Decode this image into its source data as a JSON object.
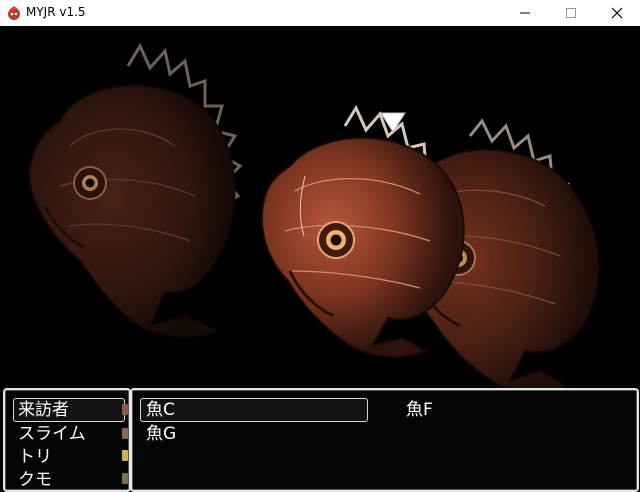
{
  "window": {
    "title": "MYJR v1.5",
    "minimize_glyph": "—",
    "maximize_glyph": "☐",
    "close_glyph": "✕"
  },
  "battle": {
    "cursor_icon": "down-triangle",
    "enemies": [
      "fish-left",
      "fish-center",
      "fish-right"
    ]
  },
  "party_menu": {
    "items": [
      "来訪者",
      "スライム",
      "トリ",
      "クモ"
    ]
  },
  "target_menu": {
    "items": [
      "魚C",
      "魚F",
      "魚G"
    ],
    "selected_index": 0
  },
  "colors": {
    "window_border": "#e6e6e6",
    "window_bg": "#050505",
    "text": "#ffffff",
    "fish_body": "#6b2e1c",
    "fish_highlight": "#a4492c",
    "fin": "#c9b7ad"
  }
}
